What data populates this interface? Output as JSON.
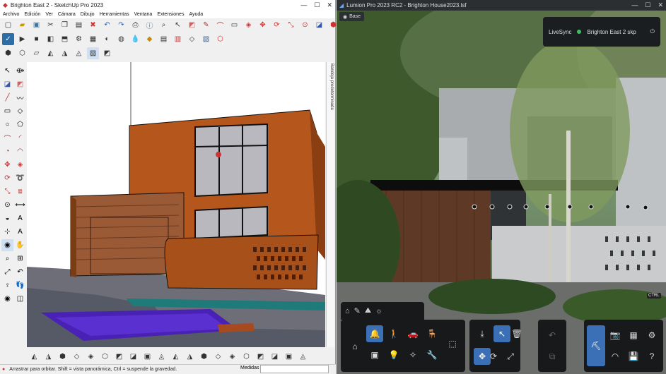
{
  "sketchup": {
    "title": "Brighton East 2 - SketchUp Pro 2023",
    "menu": [
      "Archivo",
      "Edición",
      "Ver",
      "Cámara",
      "Dibujo",
      "Herramientas",
      "Ventana",
      "Extensiones",
      "Ayuda"
    ],
    "side_tab_label": "Bandeja predeterminada",
    "status_text": "Arrastrar para orbitar. Shift = vista panorámica, Ctrl = suspende la gravedad.",
    "measure_label": "Medidas",
    "measure_value": ""
  },
  "lumion": {
    "title": "Lumion Pro 2023 RC2 - Brighton House2023.lsf",
    "base_label": "Base",
    "livesync_label": "LiveSync",
    "livesync_file": "Brighton East 2 skp",
    "ctrl_label": "CTRL"
  },
  "colors": {
    "accent_blue": "#3b6fb6",
    "livesync_green": "#3fbf5f",
    "facade_orange": "#b5561c",
    "wood": "#8b4f2a"
  }
}
